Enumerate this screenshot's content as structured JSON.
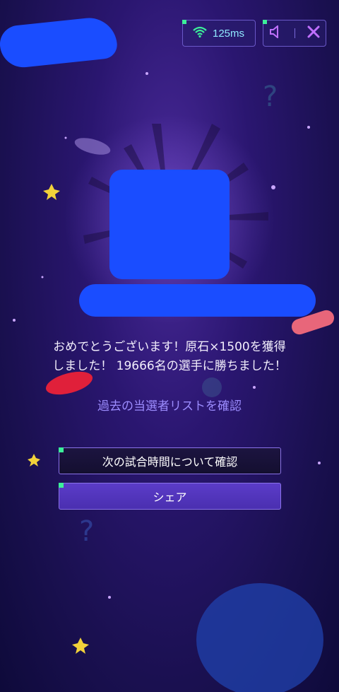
{
  "status": {
    "ping_label": "125ms",
    "wifi_icon": "wifi-icon",
    "sound_icon": "speaker-icon",
    "close_icon": "close-icon",
    "accent_color": "#3cf09a"
  },
  "result": {
    "message_line1": "おめでとうございます！原石×1500を獲得",
    "message_line2": "しました！ 19666名の選手に勝ちました！"
  },
  "links": {
    "past_winners": "過去の当選者リストを確認"
  },
  "buttons": {
    "next_match": "次の試合時間について確認",
    "share": "シェア"
  }
}
